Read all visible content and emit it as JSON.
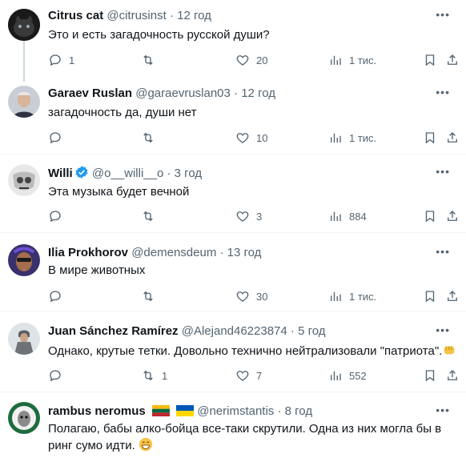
{
  "posts": [
    {
      "name": "Citrus cat",
      "handle": "@citrusinst",
      "time": "12 год",
      "text": "Это и есть загадочность русской души?",
      "stats": {
        "replies": "1",
        "reposts": "",
        "likes": "20",
        "views": "1 тис."
      }
    },
    {
      "name": "Garaev Ruslan",
      "handle": "@garaevruslan03",
      "time": "12 год",
      "text": "загадочность да, души нет",
      "stats": {
        "replies": "",
        "reposts": "",
        "likes": "10",
        "views": "1 тис."
      }
    },
    {
      "name": "Willi",
      "handle": "@o__willi__o",
      "time": "3 год",
      "text": "Эта музыка будет вечной",
      "stats": {
        "replies": "",
        "reposts": "",
        "likes": "3",
        "views": "884"
      }
    },
    {
      "name": "Ilia Prokhorov",
      "handle": "@demensdeum",
      "time": "13 год",
      "text": "В мире животных",
      "stats": {
        "replies": "",
        "reposts": "",
        "likes": "30",
        "views": "1 тис."
      }
    },
    {
      "name": "Juan Sánchez Ramírez",
      "handle": "@Alejand46223874",
      "time": "5 год",
      "text": "Однако, крутые тетки. Довольно технично нейтрализовали \"патриота\".",
      "stats": {
        "replies": "",
        "reposts": "1",
        "likes": "7",
        "views": "552"
      }
    },
    {
      "name": "rambus neromus",
      "handle": "@nerimstantis",
      "time": "8 год",
      "text": "Полагаю, бабы алко-бойца все-таки скрутили. Одна из них могла бы в ринг сумо идти.",
      "stats": {
        "replies": "",
        "reposts": "",
        "likes": "",
        "views": ""
      }
    }
  ],
  "sep": "·",
  "icons": [
    "reply-icon",
    "repost-icon",
    "like-icon",
    "views-icon",
    "bookmark-icon",
    "share-icon",
    "more-icon",
    "verified-badge-icon"
  ],
  "colors": {
    "name": "#0f1419",
    "secondary": "#536471",
    "verified": "#1d9bf0",
    "divider": "#eff3f4"
  }
}
